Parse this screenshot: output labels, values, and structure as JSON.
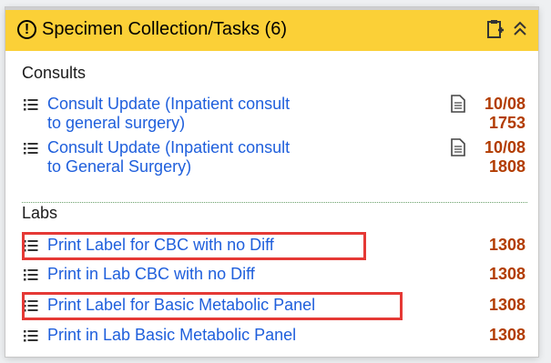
{
  "header": {
    "alert_symbol": "!",
    "title": "Specimen Collection/Tasks (6)",
    "icons": [
      "alert-icon",
      "clipboard-add-icon",
      "double-chevron-up-icon"
    ],
    "accent_color": "#fbd037"
  },
  "consults": {
    "title": "Consults",
    "items": [
      {
        "line1": "Consult Update (Inpatient consult",
        "line2": "to general surgery)",
        "date": "10/08",
        "time": "1753"
      },
      {
        "line1": "Consult Update (Inpatient consult",
        "line2": "to General Surgery)",
        "date": "10/08",
        "time": "1808"
      }
    ]
  },
  "labs": {
    "title": "Labs",
    "items": [
      {
        "label": "Print Label for CBC with no Diff",
        "time": "1308"
      },
      {
        "label": "Print in Lab CBC with no Diff",
        "time": "1308"
      },
      {
        "label": "Print Label for Basic Metabolic Panel",
        "time": "1308"
      },
      {
        "label": "Print in Lab Basic Metabolic Panel",
        "time": "1308"
      }
    ]
  },
  "colors": {
    "link": "#1f5fdc",
    "time": "#b23c00",
    "highlight": "#e53935"
  }
}
